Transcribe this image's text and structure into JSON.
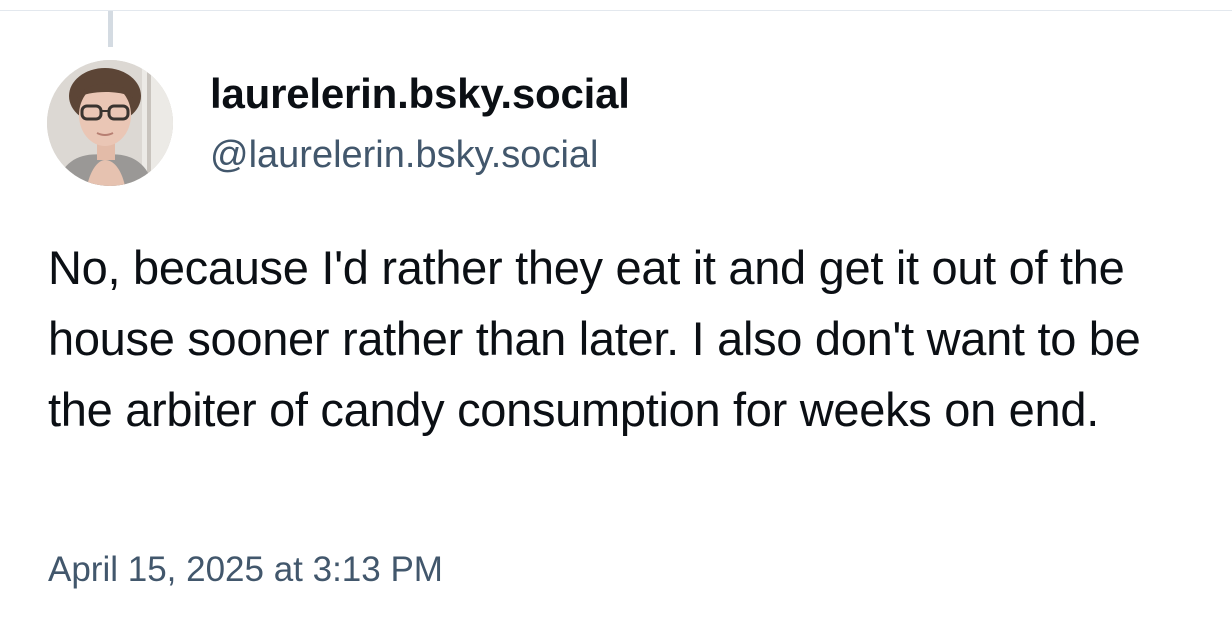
{
  "post": {
    "display_name": "laurelerin.bsky.social",
    "handle": "@laurelerin.bsky.social",
    "text": "No, because I'd rather they eat it and get it out of the house sooner rather than later. I also don't want to be the arbiter of candy consumption for weeks on end.",
    "timestamp": "April 15, 2025 at 3:13 PM"
  },
  "colors": {
    "text_primary": "#0b0f14",
    "text_secondary": "#42576c",
    "divider": "#e3e8ee",
    "thread_line": "#d4dbe2"
  }
}
